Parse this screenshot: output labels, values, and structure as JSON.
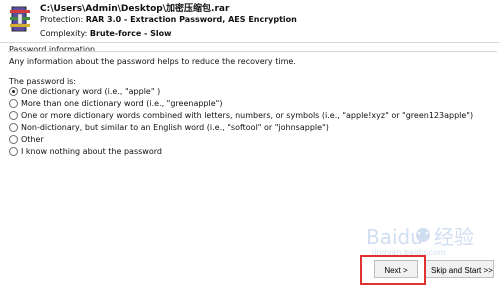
{
  "header": {
    "file_path": "C:\\Users\\Admin\\Desktop\\加密压缩包.rar",
    "protection_label": "Protection:",
    "protection_value": "RAR 3.0 - Extraction Password, AES Encryption",
    "complexity_label": "Complexity:",
    "complexity_value": "Brute-force - Slow",
    "icon": "winrar-archive-icon"
  },
  "password_information": {
    "title": "Password information",
    "description": "Any information about the password helps to reduce the recovery time.",
    "question": "The password is:",
    "options": [
      {
        "label": "One dictionary word (i.e., \"apple\" )",
        "selected": true
      },
      {
        "label": "More than one dictionary word (i.e., \"greenapple\")",
        "selected": false
      },
      {
        "label": "One or more dictionary words combined with letters, numbers, or symbols (i.e., \"apple!xyz\" or \"green123apple\")",
        "selected": false
      },
      {
        "label": "Non-dictionary, but similar to an English word (i.e., \"softool\" or \"johnsapple\")",
        "selected": false
      },
      {
        "label": "Other",
        "selected": false
      },
      {
        "label": "I know nothing about the password",
        "selected": false
      }
    ]
  },
  "buttons": {
    "next": "Next >",
    "skip_and_start": "Skip and Start >>"
  },
  "watermark": {
    "brand_text": "Baidu",
    "chinese_text": "经验",
    "domain_text": "jingyan.baidu.com"
  },
  "colors": {
    "highlight_border": "#e03232"
  }
}
